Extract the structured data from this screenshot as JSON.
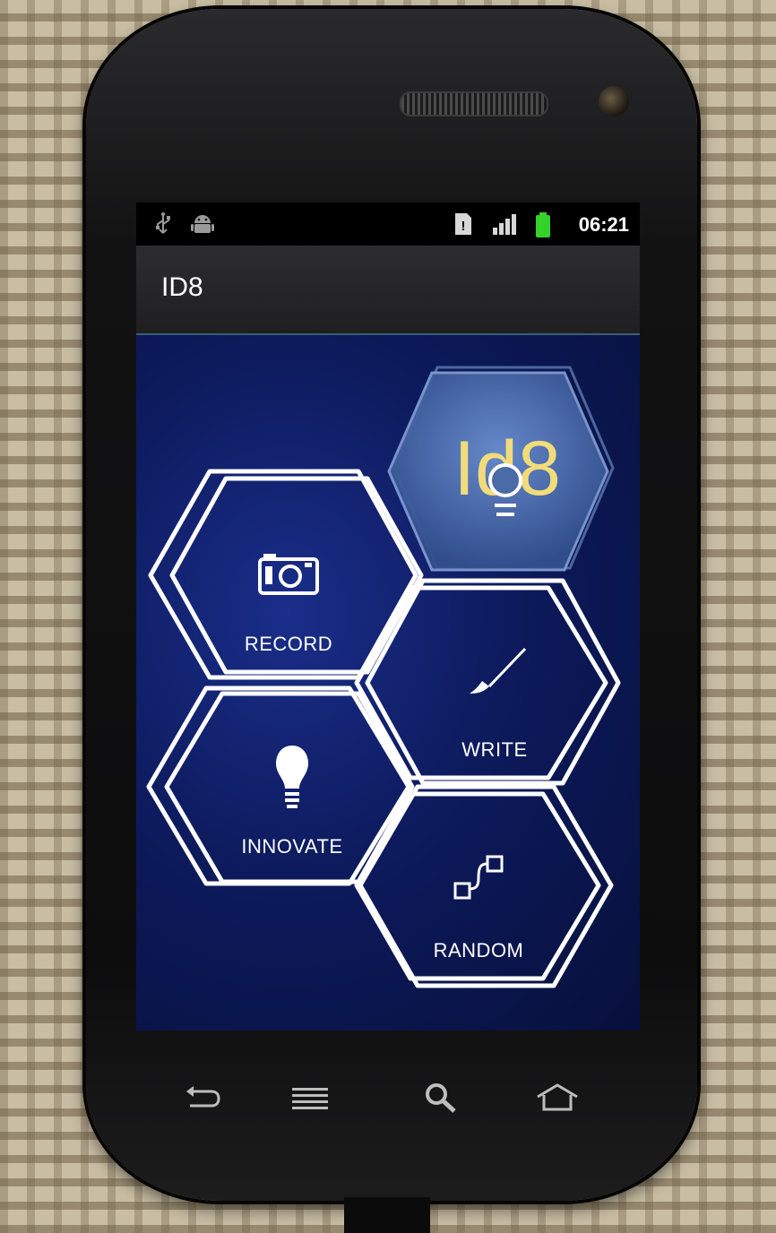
{
  "status_bar": {
    "time": "06:21",
    "icons": [
      "usb-icon",
      "android-debug-icon",
      "sim-alert-icon",
      "signal-icon",
      "battery-icon"
    ],
    "battery_color": "#35d12b"
  },
  "app": {
    "title": "ID8",
    "logo_text": "Id8"
  },
  "menu": {
    "record": {
      "label": "RECORD",
      "icon": "camera-icon"
    },
    "write": {
      "label": "WRITE",
      "icon": "brush-icon"
    },
    "innovate": {
      "label": "INNOVATE",
      "icon": "lightbulb-icon"
    },
    "random": {
      "label": "RANDOM",
      "icon": "random-squares-icon"
    }
  },
  "nav": {
    "buttons": [
      "back-icon",
      "menu-icon",
      "search-icon",
      "home-icon"
    ]
  },
  "colors": {
    "background_blue": "#0d1a5c",
    "logo_hex": "#4a6aa8",
    "logo_text": "#f2dc7a",
    "hex_stroke": "#ffffff"
  }
}
